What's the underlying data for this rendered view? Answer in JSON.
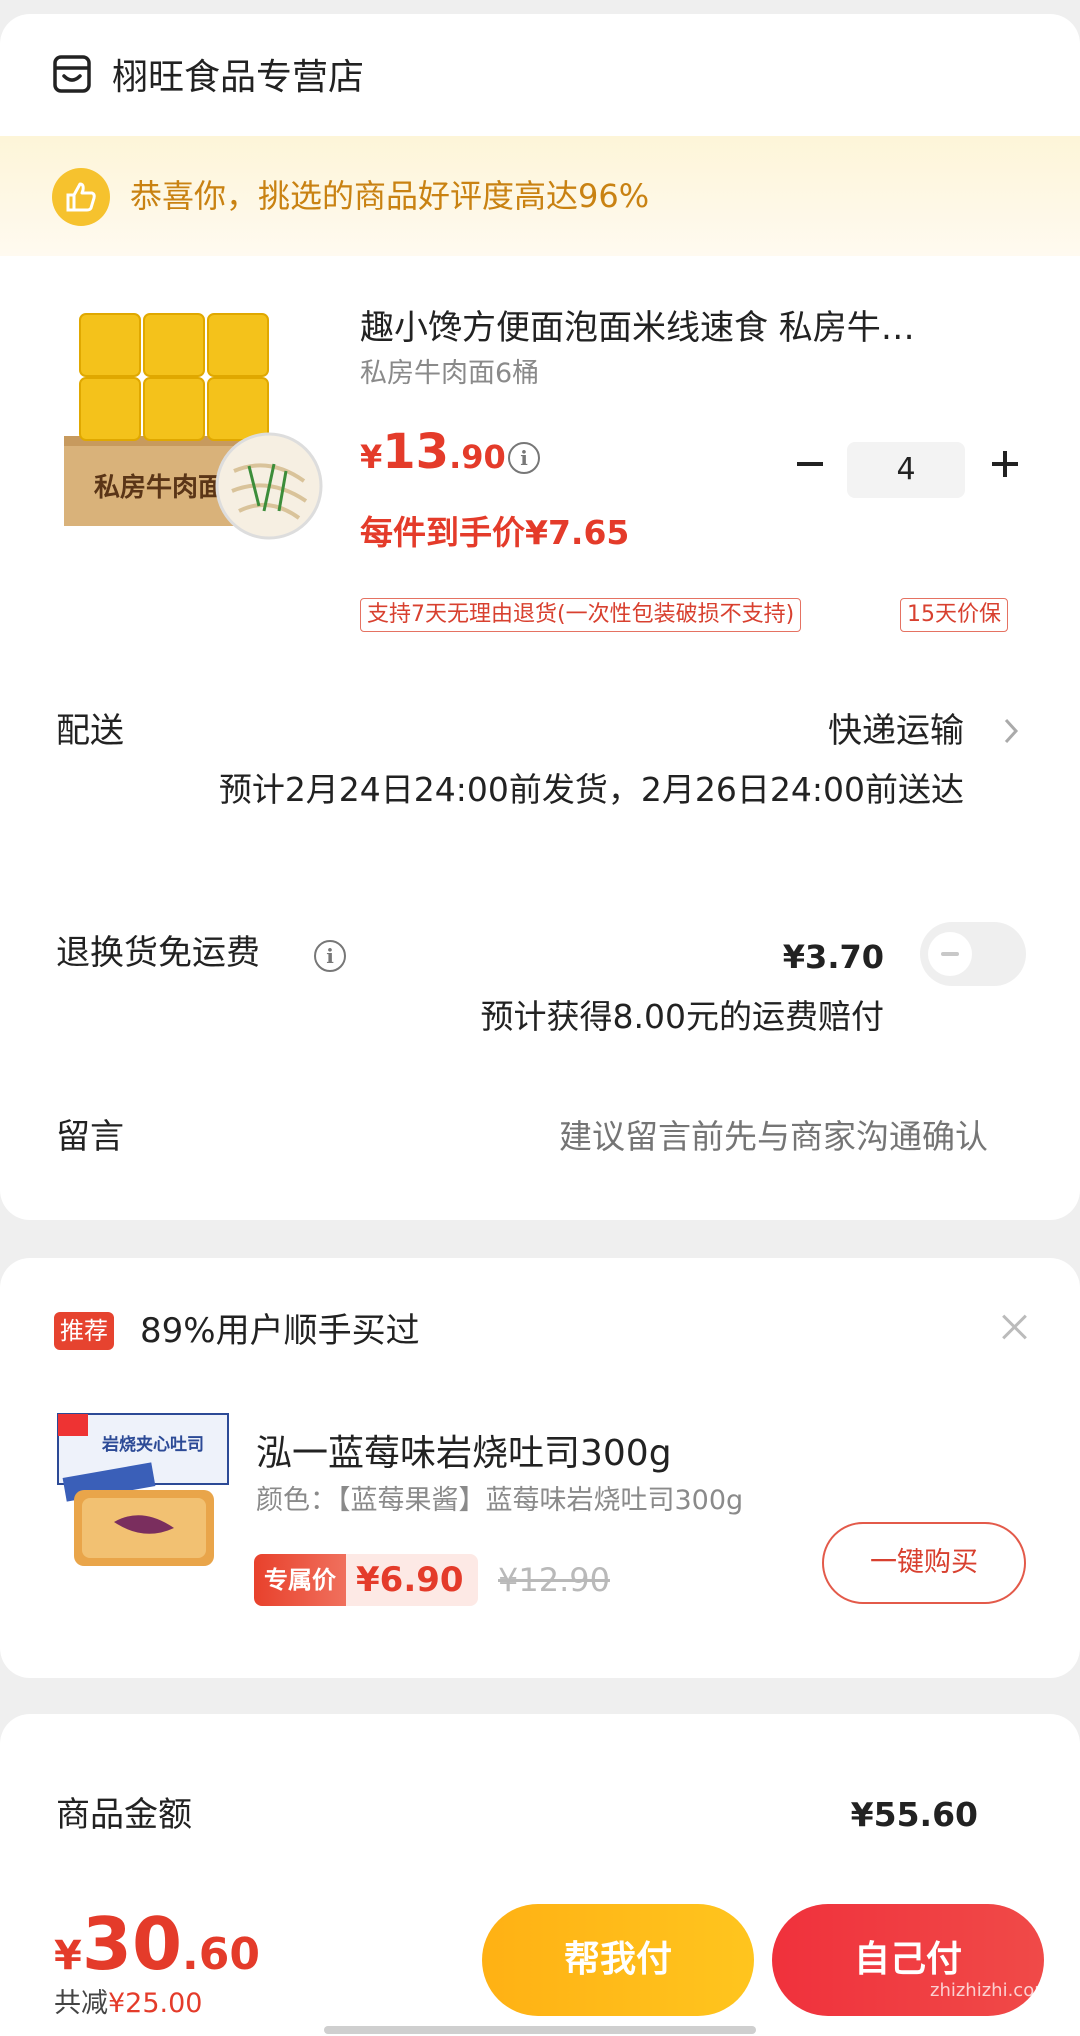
{
  "store": {
    "name": "栩旺食品专营店"
  },
  "banner": {
    "text": "恭喜你，挑选的商品好评度高达96%"
  },
  "product": {
    "title": "趣小馋方便面泡面米线速食 私房牛…",
    "spec": "私房牛肉面6桶",
    "price_symbol": "¥",
    "price_int": "13",
    "price_dec": ".90",
    "unit_price": "每件到手价¥7.65",
    "quantity": "4",
    "tags": [
      "支持7天无理由退货(一次性包装破损不支持)",
      "15天价保"
    ]
  },
  "delivery": {
    "label": "配送",
    "method": "快递运输",
    "estimate": "预计2月24日24:00前发货，2月26日24:00前送达"
  },
  "return_shipping": {
    "label": "退换货免运费",
    "price": "¥3.70",
    "compensation": "预计获得8.00元的运费赔付",
    "enabled": false
  },
  "note": {
    "label": "留言",
    "placeholder": "建议留言前先与商家沟通确认"
  },
  "recommendation": {
    "badge": "推荐",
    "title": "89%用户顺手买过",
    "product_name": "泓一蓝莓味岩烧吐司300g",
    "spec": "颜色：【蓝莓果酱】蓝莓味岩烧吐司300g",
    "exclusive_label": "专属价",
    "price": "¥6.90",
    "original_price": "¥12.90",
    "buy_button": "一键购买"
  },
  "summary": {
    "goods_amount_label": "商品金额",
    "goods_amount_value": "¥55.60"
  },
  "checkout": {
    "total_symbol": "¥",
    "total_int": "30",
    "total_dec": ".60",
    "saved_prefix": "共减",
    "saved_amount": "¥25.00",
    "help_pay_button": "帮我付",
    "self_pay_button": "自己付"
  },
  "watermark": "zhizhizhi.com",
  "colors": {
    "accent_red": "#e43b2a",
    "banner_text": "#c98212",
    "help_button": "#ffb114",
    "pay_button": "#f0313c"
  }
}
